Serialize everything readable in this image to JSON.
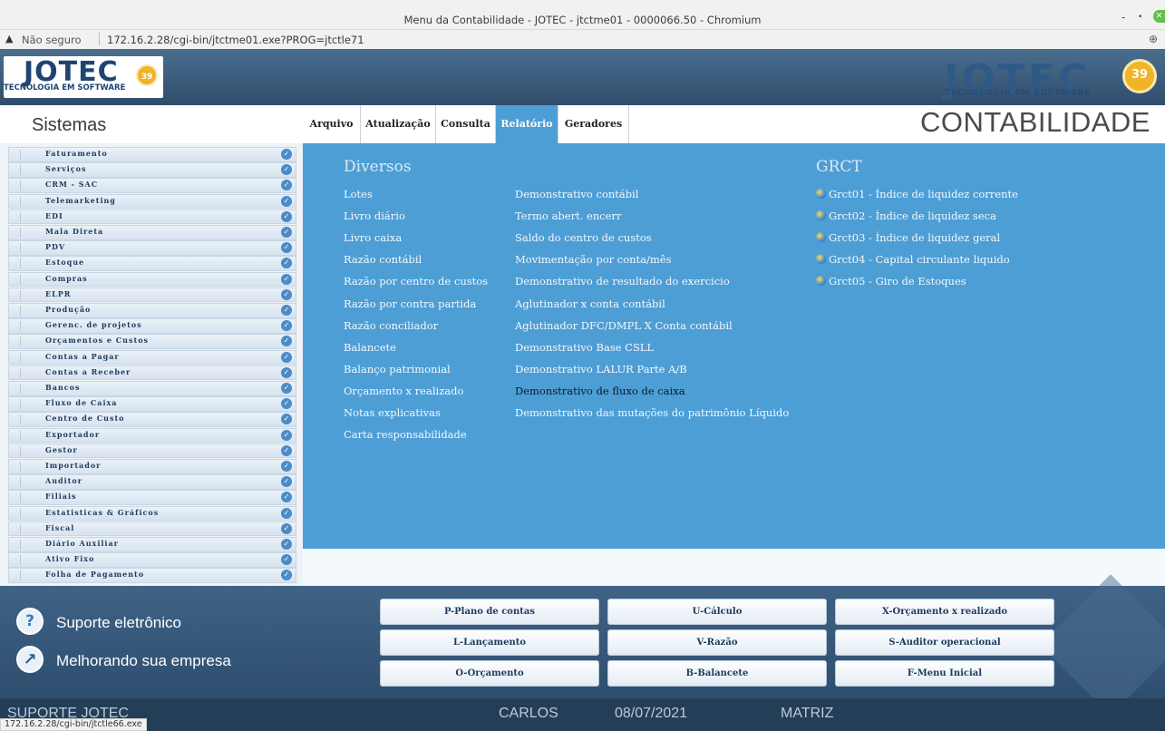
{
  "window": {
    "title": "Menu da Contabilidade - JOTEC - jtctme01 - 0000066.50 - Chromium",
    "minimize_glyph": "-",
    "restore_glyph": "•",
    "close_glyph": "✕"
  },
  "addressbar": {
    "warning_glyph": "▲",
    "security_label": "Não seguro",
    "url": "172.16.2.28/cgi-bin/jtctme01.exe?PROG=jtctle71",
    "zoom_glyph": "⊕"
  },
  "banner": {
    "logo_text": "JOTEC",
    "logo_subtext": "TECNOLOGIA EM SOFTWARE",
    "badge_years": "39"
  },
  "sidebar": {
    "title": "Sistemas",
    "check_glyph": "✓",
    "items": [
      "Faturamento",
      "Serviços",
      "CRM - SAC",
      "Telemarketing",
      "EDI",
      "Mala Direta",
      "PDV",
      "Estoque",
      "Compras",
      "ELPR",
      "Produção",
      "Gerenc. de projetos",
      "Orçamentos e Custos",
      "Contas a Pagar",
      "Contas a Receber",
      "Bancos",
      "Fluxo de Caixa",
      "Centro de Custo",
      "Exportador",
      "Gestor",
      "Importador",
      "Auditor",
      "Filiais",
      "Estatisticas & Gráficos",
      "Fiscal",
      "Diário Auxiliar",
      "Ativo Fixo",
      "Folha de Pagamento"
    ]
  },
  "menubar": {
    "items": [
      "Arquivo",
      "Atualização",
      "Consulta",
      "Relatório",
      "Geradores"
    ],
    "active": "Relatório",
    "app_title": "CONTABILIDADE"
  },
  "main": {
    "diversos_title": "Diversos",
    "col1": [
      "Lotes",
      "Livro diário",
      "Livro caixa",
      "Razão contábil",
      "Razão por centro de custos",
      "Razão por contra partida",
      "Razão conciliador",
      "Balancete",
      "Balanço patrimonial",
      "Orçamento x realizado",
      "Notas explicativas",
      "Carta responsabilidade"
    ],
    "col2": [
      "Demonstrativo contábil",
      "Termo abert. encerr",
      "Saldo do centro de custos",
      "Movimentação por conta/mês",
      "Demonstrativo de resultado do exercicio",
      "Aglutinador x conta contábil",
      "Aglutinador DFC/DMPL X Conta contábil",
      "Demonstrativo Base CSLL",
      "Demonstrativo LALUR Parte A/B",
      "Demonstrativo de fluxo de caixa",
      "Demonstrativo das mutações do patrimônio Líquido"
    ],
    "col2_highlighted": "Demonstrativo de fluxo de caixa",
    "grct_title": "GRCT",
    "grct": [
      "Grct01 - Índice de liquidez corrente",
      "Grct02 - Índice de liquidez seca",
      "Grct03 - Índice de liquidez geral",
      "Grct04 - Capital circulante liquido",
      "Grct05 - Giro de Estoques"
    ]
  },
  "bottom": {
    "support_label": "Suporte eletrônico",
    "improve_label": "Melhorando sua empresa",
    "quick_buttons": [
      "P-Plano de contas",
      "U-Cálculo",
      "X-Orçamento x realizado",
      "L-Lançamento",
      "V-Razão",
      "S-Auditor operacional",
      "O-Orçamento",
      "B-Balancete",
      "F-Menu Inicial"
    ]
  },
  "statusbar": {
    "support": "SUPORTE JOTEC",
    "user": "CARLOS",
    "date": "08/07/2021",
    "branch": "MATRIZ",
    "link_hint": "172.16.2.28/cgi-bin/jtctle66.exe"
  },
  "colors": {
    "panel_blue": "#4d9ed5",
    "banner_blue": "#3c5c7c",
    "status_dark": "#243e58"
  }
}
